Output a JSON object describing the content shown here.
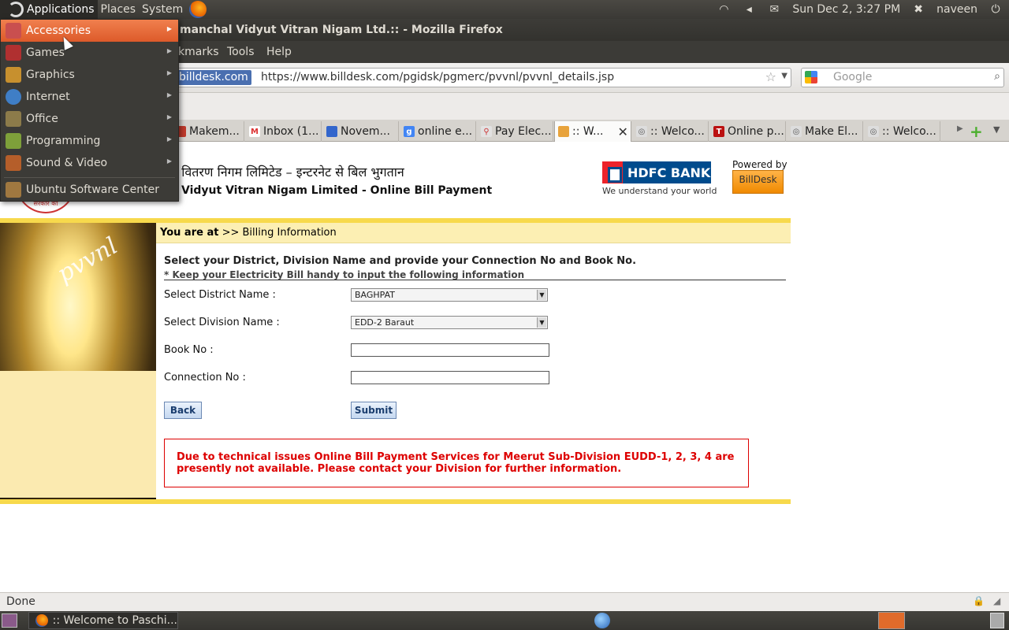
{
  "top_panel": {
    "applications": "Applications",
    "places": "Places",
    "system": "System",
    "clock": "Sun Dec  2,  3:27 PM",
    "user": "naveen",
    "icons": [
      "wifi-icon",
      "volume-icon",
      "mail-icon",
      "user-status-icon",
      "power-icon"
    ]
  },
  "window": {
    "title": "manchal Vidyut Vitran Nigam Ltd.:: - Mozilla Firefox"
  },
  "menubar": {
    "items": [
      "kmarks",
      "Tools",
      "Help"
    ]
  },
  "navbar": {
    "identity": "billdesk.com",
    "url": "https://www.billdesk.com/pgidsk/pgmerc/pvvnl/pvvnl_details.jsp",
    "search_placeholder": "Google"
  },
  "tabs": [
    {
      "label": "Makem..."
    },
    {
      "label": "Inbox (1..."
    },
    {
      "label": "Novem..."
    },
    {
      "label": "online e..."
    },
    {
      "label": "Pay Elec..."
    },
    {
      "label": ":: W..."
    },
    {
      "label": ":: Welco..."
    },
    {
      "label": "Online p..."
    },
    {
      "label": "Make El..."
    },
    {
      "label": ":: Welco..."
    }
  ],
  "page": {
    "hindi_header": "त वितरण निगम लिमिटेड – इन्टरनेट से बिल भुगतान",
    "english_header": "Vidyut Vitran Nigam Limited - Online Bill Payment",
    "seal_text": "सरकार का",
    "bulb_text": "pvvnl",
    "hdfc_name": "HDFC BANK",
    "hdfc_tagline": "We understand your world",
    "powered_by": "Powered by",
    "billdesk": "BillDesk",
    "breadcrumb_prefix": "You are at",
    "breadcrumb_path": " >> Billing Information",
    "instruction": "Select your District, Division Name and provide your Connection No and Book No.",
    "note": "* Keep your Electricity Bill handy to input the following information",
    "district_label": "Select District Name :",
    "district_value": "BAGHPAT",
    "division_label": "Select Division Name :",
    "division_value": "EDD-2 Baraut",
    "book_label": "Book No :",
    "book_value": "",
    "connection_label": "Connection No :",
    "connection_value": "",
    "back_button": "Back",
    "submit_button": "Submit",
    "notice": "Due to technical issues Online Bill Payment Services for Meerut Sub-Division EUDD-1, 2, 3, 4 are presently not available. Please contact your Division for further information."
  },
  "statusbar": {
    "text": "Done"
  },
  "bottom_panel": {
    "task": ":: Welcome to Paschi..."
  },
  "apps_menu": {
    "items": [
      {
        "label": "Accessories",
        "icon": "accessories-icon",
        "color": "#c94f4f"
      },
      {
        "label": "Games",
        "icon": "games-icon",
        "color": "#b03030"
      },
      {
        "label": "Graphics",
        "icon": "graphics-icon",
        "color": "#c7902e"
      },
      {
        "label": "Internet",
        "icon": "internet-icon",
        "color": "#3f7ec6"
      },
      {
        "label": "Office",
        "icon": "office-icon",
        "color": "#8c7b4a"
      },
      {
        "label": "Programming",
        "icon": "programming-icon",
        "color": "#7ea03a"
      },
      {
        "label": "Sound & Video",
        "icon": "sound-video-icon",
        "color": "#b55e2a"
      },
      {
        "label": "Ubuntu Software Center",
        "icon": "software-center-icon",
        "color": "#a07840"
      }
    ]
  },
  "colors": {
    "menu_highlight": "#dd5a2a",
    "band_yellow": "#f7d94c",
    "notice_red": "#dd0000",
    "hdfc_blue": "#004b8d",
    "hdfc_red": "#ed232a"
  }
}
